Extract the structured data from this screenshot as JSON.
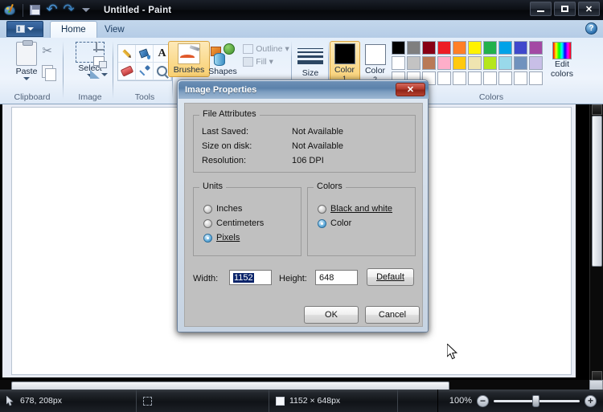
{
  "window": {
    "title": "Untitled - Paint",
    "logo_icon": "paint-palette-icon",
    "quick_access": [
      {
        "name": "save-icon",
        "label": "Save"
      },
      {
        "name": "undo-icon",
        "label": "Undo"
      },
      {
        "name": "redo-icon",
        "label": "Redo"
      },
      {
        "name": "chevron-down-icon",
        "label": "Customize Quick Access Toolbar"
      }
    ],
    "buttons": {
      "minimize": "—",
      "maximize": "□",
      "close": "✕"
    }
  },
  "ribbon": {
    "file_menu_label": "",
    "tabs": [
      {
        "label": "Home",
        "active": true
      },
      {
        "label": "View",
        "active": false
      }
    ],
    "help_label": "?",
    "groups": [
      {
        "label": "Clipboard",
        "items": [
          {
            "label": "Paste",
            "icon": "clipboard-icon",
            "has_dropdown": true
          },
          {
            "label": "",
            "icon": "scissors-icon"
          },
          {
            "label": "",
            "icon": "copy-icon"
          }
        ]
      },
      {
        "label": "Image",
        "items": [
          {
            "label": "Select",
            "icon": "selection-rect-icon",
            "has_dropdown": true
          },
          {
            "label": "",
            "icon": "crop-icon"
          },
          {
            "label": "",
            "icon": "resize-icon"
          },
          {
            "label": "",
            "icon": "rotate-icon"
          }
        ]
      },
      {
        "label": "Tools",
        "items": [
          {
            "label": "",
            "icon": "pencil-icon"
          },
          {
            "label": "",
            "icon": "fill-with-color-icon"
          },
          {
            "label": "",
            "icon": "text-icon"
          },
          {
            "label": "",
            "icon": "eraser-icon"
          },
          {
            "label": "",
            "icon": "color-picker-icon"
          },
          {
            "label": "",
            "icon": "magnifier-icon"
          }
        ]
      },
      {
        "label": "",
        "items": [
          {
            "label": "Brushes",
            "icon": "brush-icon",
            "selected": true
          },
          {
            "label": "Shapes",
            "icon": "shapes-icon"
          },
          {
            "label": "Outline",
            "icon": "outline-icon",
            "disabled": true
          },
          {
            "label": "Fill",
            "icon": "fill-icon",
            "disabled": true
          }
        ]
      },
      {
        "label": "",
        "items": [
          {
            "label": "Size",
            "icon": "line-size-icon"
          }
        ]
      },
      {
        "label": "",
        "items": [
          {
            "label": "Color",
            "sublabel": "1",
            "icon": "color1-swatch",
            "color": "#000000",
            "selected": true
          },
          {
            "label": "Color",
            "sublabel": "2",
            "icon": "color2-swatch",
            "color": "#ffffff"
          }
        ]
      },
      {
        "label": "Colors",
        "edit_colors_label_line1": "Edit",
        "edit_colors_label_line2": "colors"
      }
    ],
    "palette_row1": [
      "#000000",
      "#7f7f7f",
      "#880015",
      "#ed1c24",
      "#ff7f27",
      "#fff200",
      "#22b14c",
      "#00a2e8",
      "#3f48cc",
      "#a349a4"
    ],
    "palette_row2": [
      "#ffffff",
      "#c3c3c3",
      "#b97a57",
      "#ffaec9",
      "#ffc90e",
      "#efe4b0",
      "#b5e61d",
      "#99d9ea",
      "#7092be",
      "#c8bfe7"
    ],
    "palette_row3": [
      "#ffffff",
      "#ffffff",
      "#ffffff",
      "#ffffff",
      "#ffffff",
      "#ffffff",
      "#ffffff",
      "#ffffff",
      "#ffffff",
      "#ffffff"
    ]
  },
  "dialog": {
    "title": "Image Properties",
    "close_label": "✕",
    "file_attributes": {
      "legend": "File Attributes",
      "rows": [
        {
          "label": "Last Saved:",
          "value": "Not Available"
        },
        {
          "label": "Size on disk:",
          "value": "Not Available"
        },
        {
          "label": "Resolution:",
          "value": "106 DPI"
        }
      ]
    },
    "units": {
      "legend": "Units",
      "options": [
        {
          "label": "Inches",
          "selected": false
        },
        {
          "label": "Centimeters",
          "selected": false
        },
        {
          "label": "Pixels",
          "selected": true
        }
      ]
    },
    "colors": {
      "legend": "Colors",
      "options": [
        {
          "label": "Black and white",
          "selected": false
        },
        {
          "label": "Color",
          "selected": true
        }
      ]
    },
    "width_label": "Width:",
    "width_value": "1152",
    "height_label": "Height:",
    "height_value": "648",
    "default_button": "Default",
    "ok_button": "OK",
    "cancel_button": "Cancel"
  },
  "statusbar": {
    "cursor_position": "678, 208px",
    "selection_size": "",
    "image_size": "1152 × 648px",
    "zoom_level": "100%",
    "zoom_out_label": "−",
    "zoom_in_label": "+"
  }
}
